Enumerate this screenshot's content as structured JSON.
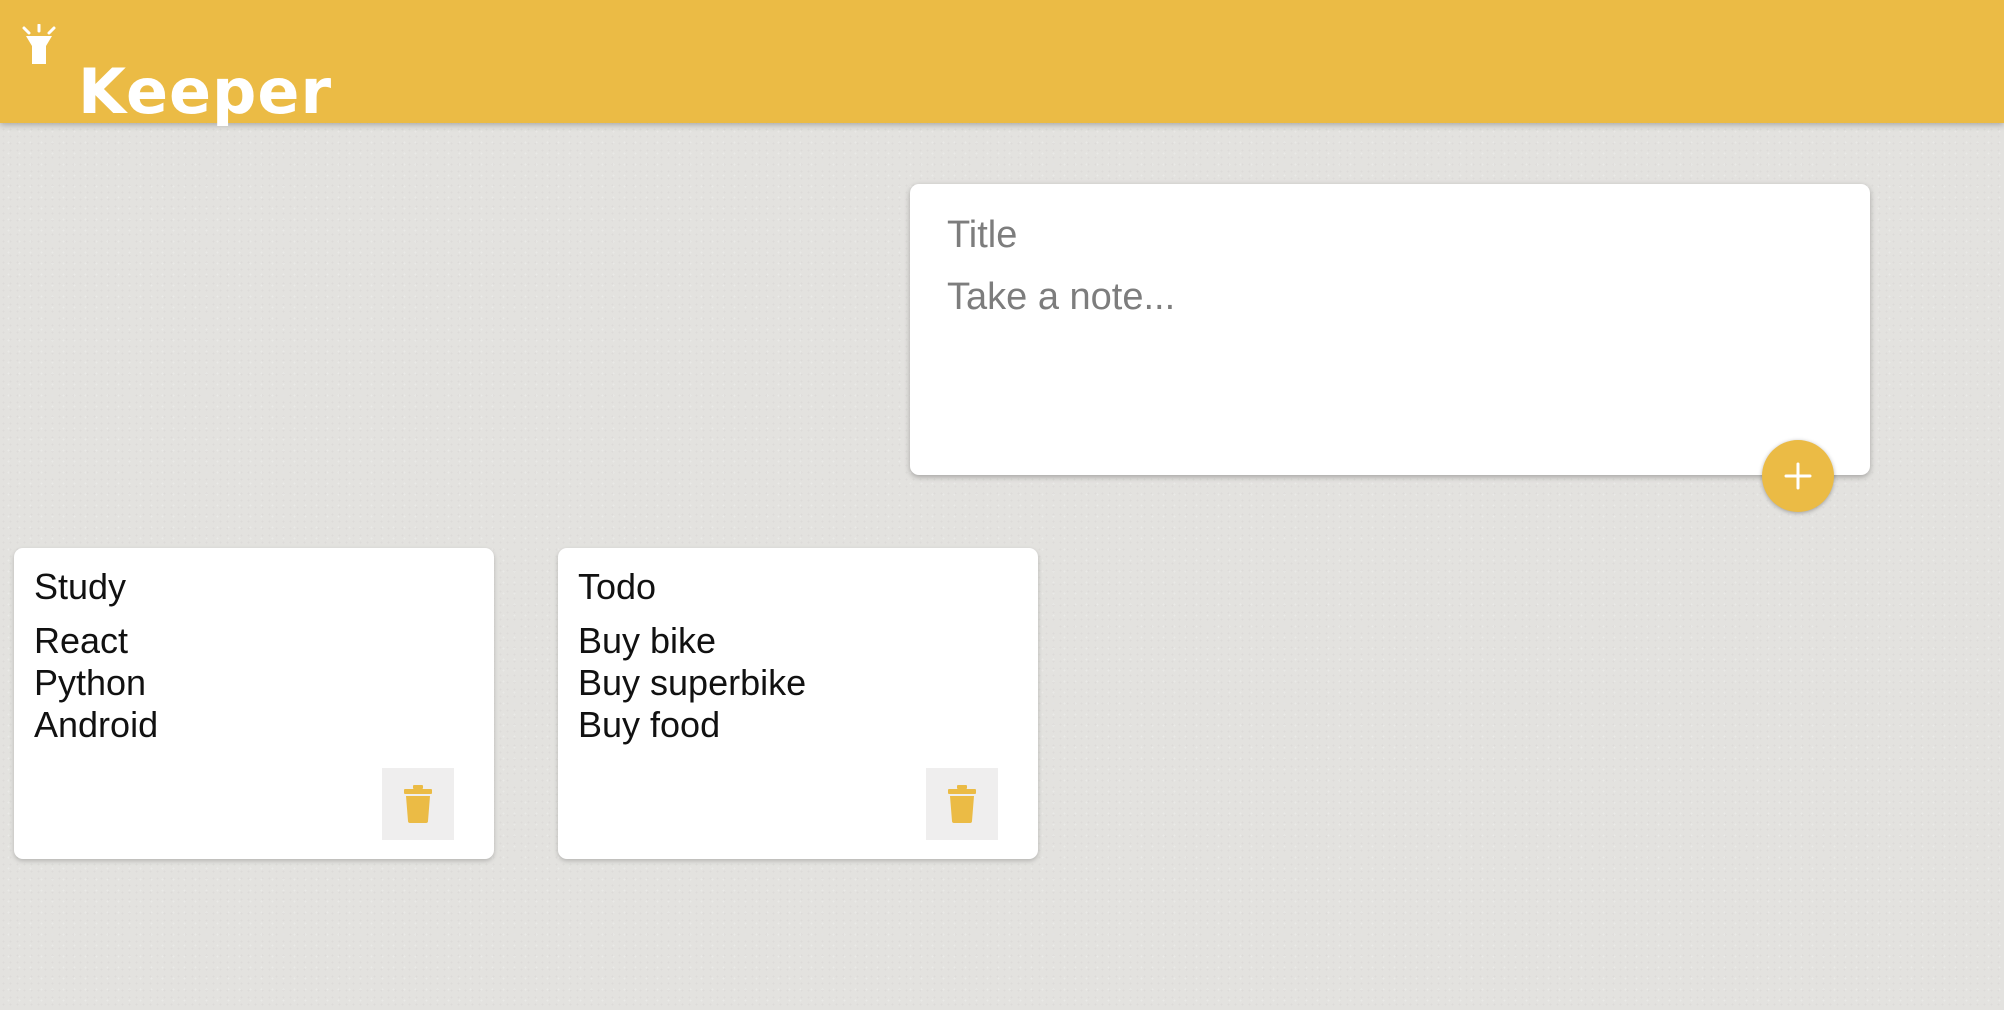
{
  "header": {
    "title": "Keeper",
    "icon": "highlight-lamp-icon",
    "color": "#ebbb45"
  },
  "create_note": {
    "title_placeholder": "Title",
    "title_value": "",
    "content_placeholder": "Take a note...",
    "content_value": "",
    "add_button_icon": "plus-icon"
  },
  "notes": [
    {
      "title": "Study",
      "content": "React\nPython\nAndroid",
      "delete_icon": "trash-icon"
    },
    {
      "title": "Todo",
      "content": "Buy bike\nBuy superbike\nBuy food",
      "delete_icon": "trash-icon"
    }
  ],
  "colors": {
    "accent": "#ebbb45",
    "background": "#e3e2df",
    "card": "#ffffff"
  }
}
